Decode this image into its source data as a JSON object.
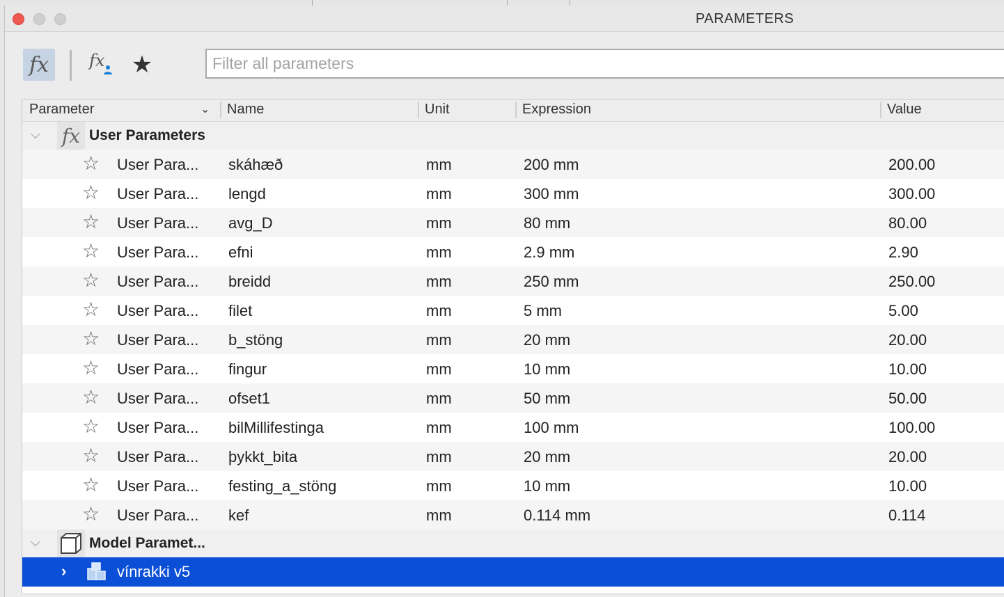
{
  "window": {
    "title": "PARAMETERS"
  },
  "toolbar": {
    "all_params_icon": "fx-icon",
    "user_params_icon": "fx-user-icon",
    "favorites_icon": "star-icon",
    "filter_placeholder": "Filter all parameters",
    "filter_value": ""
  },
  "table": {
    "columns": {
      "parameter": "Parameter",
      "name": "Name",
      "unit": "Unit",
      "expression": "Expression",
      "value": "Value"
    },
    "user_group": {
      "label": "User Parameters"
    },
    "rows": [
      {
        "parameter": "User Para...",
        "name": "skáhæð",
        "unit": "mm",
        "expression": "200 mm",
        "value": "200.00"
      },
      {
        "parameter": "User Para...",
        "name": "lengd",
        "unit": "mm",
        "expression": "300 mm",
        "value": "300.00"
      },
      {
        "parameter": "User Para...",
        "name": "avg_D",
        "unit": "mm",
        "expression": "80 mm",
        "value": "80.00"
      },
      {
        "parameter": "User Para...",
        "name": "efni",
        "unit": "mm",
        "expression": "2.9 mm",
        "value": "2.90"
      },
      {
        "parameter": "User Para...",
        "name": "breidd",
        "unit": "mm",
        "expression": "250 mm",
        "value": "250.00"
      },
      {
        "parameter": "User Para...",
        "name": "filet",
        "unit": "mm",
        "expression": "5 mm",
        "value": "5.00"
      },
      {
        "parameter": "User Para...",
        "name": "b_stöng",
        "unit": "mm",
        "expression": "20 mm",
        "value": "20.00"
      },
      {
        "parameter": "User Para...",
        "name": "fingur",
        "unit": "mm",
        "expression": "10 mm",
        "value": "10.00"
      },
      {
        "parameter": "User Para...",
        "name": "ofset1",
        "unit": "mm",
        "expression": "50 mm",
        "value": "50.00"
      },
      {
        "parameter": "User Para...",
        "name": "bilMillifestinga",
        "unit": "mm",
        "expression": "100 mm",
        "value": "100.00"
      },
      {
        "parameter": "User Para...",
        "name": "þykkt_bita",
        "unit": "mm",
        "expression": "20 mm",
        "value": "20.00"
      },
      {
        "parameter": "User Para...",
        "name": "festing_a_stöng",
        "unit": "mm",
        "expression": "10 mm",
        "value": "10.00"
      },
      {
        "parameter": "User Para...",
        "name": "kef",
        "unit": "mm",
        "expression": "0.114 mm",
        "value": "0.114"
      }
    ],
    "model_group": {
      "label": "Model Paramet..."
    },
    "component": {
      "label": "vínrakki v5"
    }
  },
  "colors": {
    "selection": "#0a4fd6",
    "close_button": "#ee5a52"
  }
}
